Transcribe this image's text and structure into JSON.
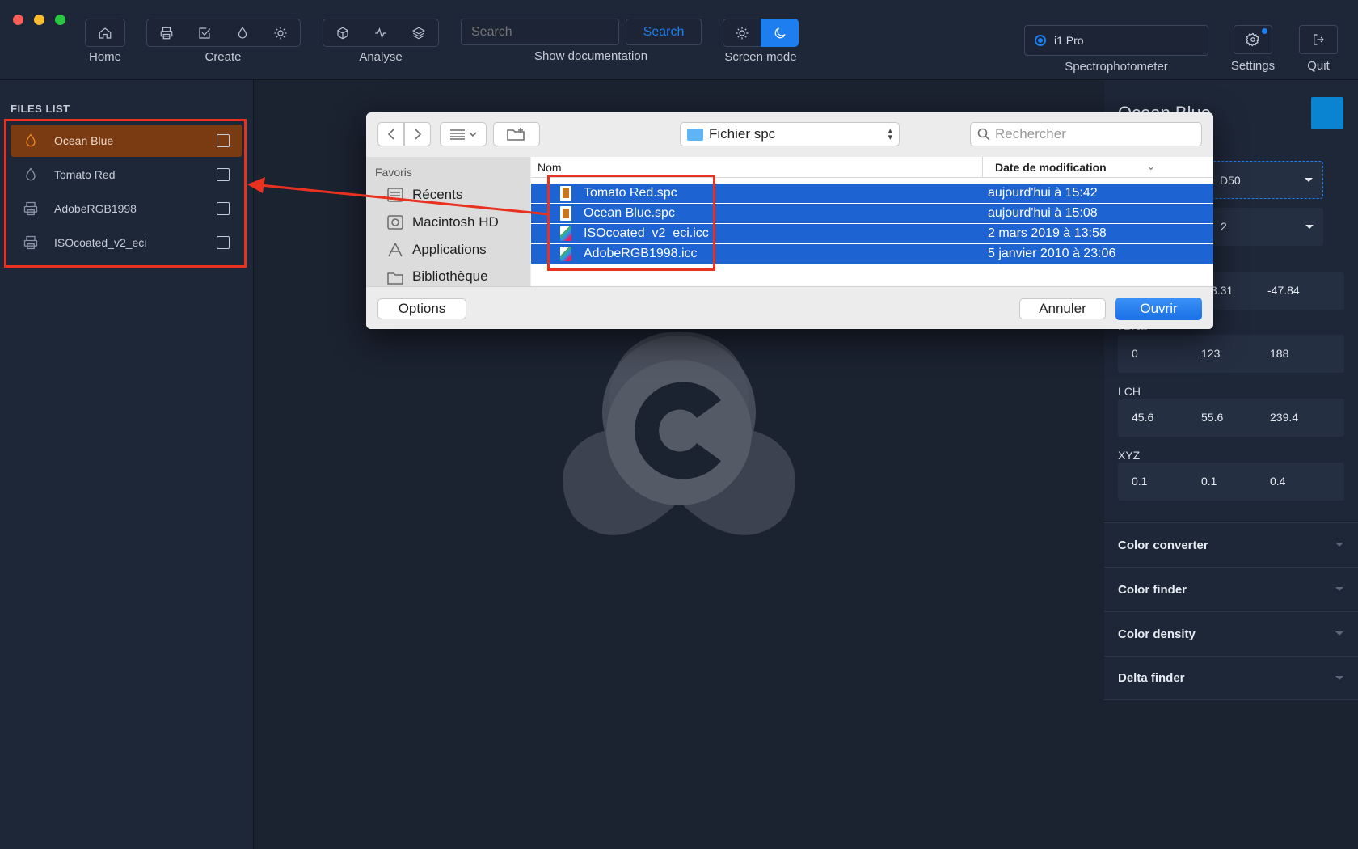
{
  "toolbar": {
    "groups": [
      {
        "label": "Home",
        "icons": [
          "home-icon"
        ]
      },
      {
        "label": "Create",
        "icons": [
          "printer-icon",
          "check-square-icon",
          "droplet-icon",
          "sun-icon"
        ]
      },
      {
        "label": "Analyse",
        "icons": [
          "cube-icon",
          "activity-icon",
          "layers-icon"
        ]
      }
    ],
    "search_placeholder": "Search",
    "search_button": "Search",
    "show_documentation": "Show documentation",
    "screen_mode_label": "Screen mode",
    "spectrophotometer_value": "i1 Pro",
    "spectrophotometer_label": "Spectrophotometer",
    "settings_label": "Settings",
    "quit_label": "Quit"
  },
  "files_list": {
    "title": "FILES LIST",
    "items": [
      {
        "name": "Ocean Blue",
        "icon": "droplet-icon",
        "selected": true
      },
      {
        "name": "Tomato Red",
        "icon": "droplet-icon",
        "selected": false
      },
      {
        "name": "AdobeRGB1998",
        "icon": "printer-icon",
        "selected": false
      },
      {
        "name": "ISOcoated_v2_eci",
        "icon": "printer-icon",
        "selected": false
      }
    ]
  },
  "right_panel": {
    "color_name": "Ocean Blue",
    "swatch_color": "#0a84d0",
    "illuminant": "D50",
    "observer": "2",
    "lab_values": [
      "3.31",
      "-47.84"
    ],
    "srgb_label": "sRGB",
    "srgb_values": [
      "0",
      "123",
      "188"
    ],
    "lch_label": "LCH",
    "lch_values": [
      "45.6",
      "55.6",
      "239.4"
    ],
    "xyz_label": "XYZ",
    "xyz_values": [
      "0.1",
      "0.1",
      "0.4"
    ],
    "accordions": [
      "Color converter",
      "Color finder",
      "Color density",
      "Delta finder"
    ]
  },
  "dialog": {
    "location": "Fichier spc",
    "search_placeholder": "Rechercher",
    "sidebar_title": "Favoris",
    "sidebar_items": [
      "Récents",
      "Macintosh HD",
      "Applications",
      "Bibliothèque"
    ],
    "col_name": "Nom",
    "col_date": "Date de modification",
    "files": [
      {
        "name": "Tomato Red.spc",
        "date": "aujourd'hui à 15:42",
        "icon": "spc-file-icon"
      },
      {
        "name": "Ocean Blue.spc",
        "date": "aujourd'hui à 15:08",
        "icon": "spc-file-icon"
      },
      {
        "name": "ISOcoated_v2_eci.icc",
        "date": "2 mars 2019 à 13:58",
        "icon": "icc-file-icon"
      },
      {
        "name": "AdobeRGB1998.icc",
        "date": "5 janvier 2010 à 23:06",
        "icon": "icc-file-icon"
      }
    ],
    "options_button": "Options",
    "cancel_button": "Annuler",
    "open_button": "Ouvrir"
  },
  "colors": {
    "accent_blue": "#1d7ef0",
    "selection_orange": "#7a3a12",
    "annotation_red": "#e8321f",
    "finder_selection": "#1e63d2"
  }
}
